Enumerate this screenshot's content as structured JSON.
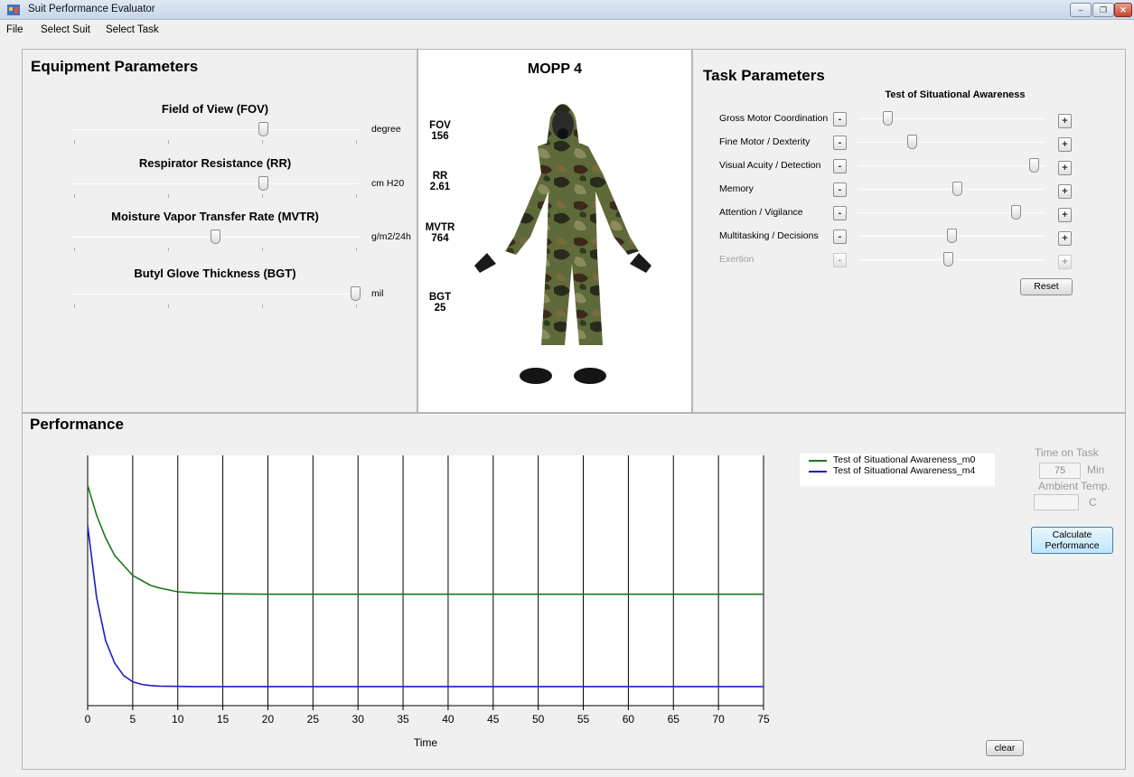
{
  "window": {
    "title": "Suit Performance Evaluator",
    "min": "‒",
    "restore": "❐",
    "close": "✕"
  },
  "menu": [
    "File",
    "Select Suit",
    "Select Task"
  ],
  "equipment": {
    "title": "Equipment Parameters",
    "sliders": [
      {
        "label": "Field of View (FOV)",
        "unit": "degree",
        "value_fraction": 0.67
      },
      {
        "label": "Respirator Resistance (RR)",
        "unit": "cm H20",
        "value_fraction": 0.67
      },
      {
        "label": "Moisture Vapor Transfer Rate (MVTR)",
        "unit": "g/m2/24h",
        "value_fraction": 0.5
      },
      {
        "label": "Butyl Glove Thickness (BGT)",
        "unit": "mil",
        "value_fraction": 1.0
      }
    ]
  },
  "suit": {
    "name": "MOPP 4",
    "readouts": [
      {
        "label": "FOV",
        "value": "156"
      },
      {
        "label": "RR",
        "value": "2.61"
      },
      {
        "label": "MVTR",
        "value": "764"
      },
      {
        "label": "BGT",
        "value": "25"
      }
    ]
  },
  "task": {
    "title": "Task Parameters",
    "test_name": "Test of Situational Awareness",
    "minus": "-",
    "plus": "+",
    "params": [
      {
        "label": "Gross Motor Coordination",
        "value_fraction": 0.15,
        "enabled": true
      },
      {
        "label": "Fine Motor / Dexterity",
        "value_fraction": 0.29,
        "enabled": true
      },
      {
        "label": "Visual Acuity / Detection",
        "value_fraction": 0.97,
        "enabled": true
      },
      {
        "label": "Memory",
        "value_fraction": 0.54,
        "enabled": true
      },
      {
        "label": "Attention / Vigilance",
        "value_fraction": 0.87,
        "enabled": true
      },
      {
        "label": "Multitasking / Decisions",
        "value_fraction": 0.51,
        "enabled": true
      },
      {
        "label": "Exertion",
        "value_fraction": 0.49,
        "enabled": false
      }
    ],
    "reset": "Reset"
  },
  "performance": {
    "title": "Performance",
    "time_on_task_label": "Time on Task",
    "time_on_task_value": "75",
    "time_unit": "Min",
    "ambient_label": "Ambient Temp.",
    "ambient_value": "",
    "temp_unit": "C",
    "calculate": "Calculate\nPerformance",
    "clear": "clear"
  },
  "colors": {
    "series_m0": "#1a7a1a",
    "series_m4": "#1c1cc8"
  },
  "chart_data": {
    "type": "line",
    "xlabel": "Time",
    "ylabel": "",
    "x_ticks": [
      0,
      5,
      10,
      15,
      20,
      25,
      30,
      35,
      40,
      45,
      50,
      55,
      60,
      65,
      70,
      75
    ],
    "xlim": [
      0,
      75
    ],
    "ylim": [
      0,
      1
    ],
    "grid": "vertical",
    "legend": "top-right",
    "series": [
      {
        "name": "Test of Situational Awareness_m0",
        "color": "#1a7a1a",
        "x": [
          0,
          1,
          2,
          3,
          4,
          5,
          6,
          7,
          8,
          10,
          12,
          15,
          20,
          25,
          30,
          40,
          50,
          60,
          70,
          75
        ],
        "y": [
          0.88,
          0.76,
          0.67,
          0.6,
          0.56,
          0.52,
          0.5,
          0.48,
          0.47,
          0.455,
          0.45,
          0.447,
          0.445,
          0.445,
          0.445,
          0.445,
          0.445,
          0.445,
          0.445,
          0.445
        ]
      },
      {
        "name": "Test of Situational Awareness_m4",
        "color": "#1c1cc8",
        "x": [
          0,
          1,
          2,
          3,
          4,
          5,
          6,
          7,
          8,
          10,
          12,
          15,
          20,
          25,
          30,
          40,
          50,
          60,
          70,
          75
        ],
        "y": [
          0.72,
          0.43,
          0.26,
          0.17,
          0.12,
          0.095,
          0.085,
          0.08,
          0.078,
          0.077,
          0.076,
          0.076,
          0.076,
          0.076,
          0.076,
          0.076,
          0.076,
          0.076,
          0.076,
          0.076
        ]
      }
    ]
  }
}
